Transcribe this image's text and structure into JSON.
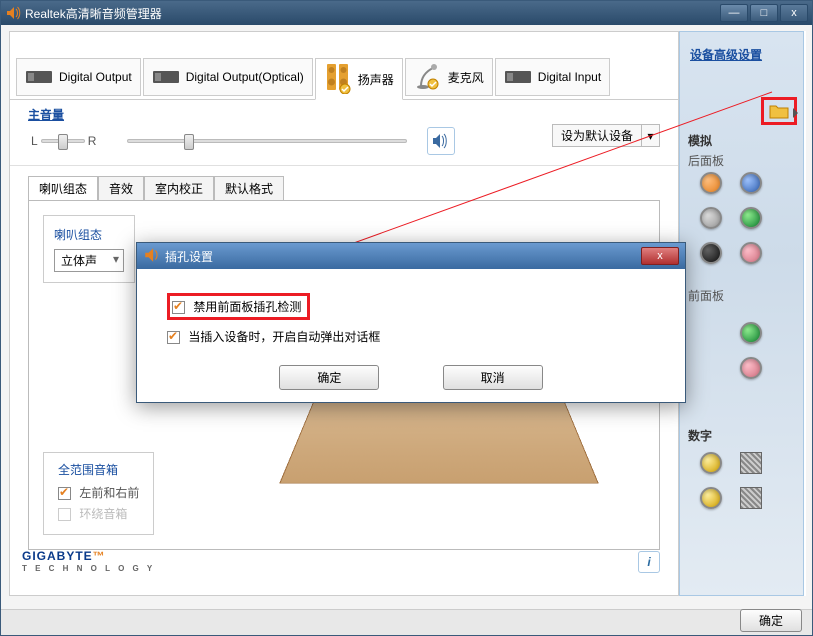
{
  "window": {
    "title": "Realtek高清晰音频管理器",
    "min": "—",
    "max": "□",
    "close": "x"
  },
  "topTabs": {
    "digitalOutput": "Digital Output",
    "digitalOutputOptical": "Digital Output(Optical)",
    "speakers": "扬声器",
    "microphone": "麦克风",
    "digitalInput": "Digital Input"
  },
  "volume": {
    "mainLabel": "主音量",
    "L": "L",
    "R": "R",
    "defaultDevice": "设为默认设备",
    "dropdownArrow": "▾"
  },
  "subTabs": {
    "config": "喇叭组态",
    "effect": "音效",
    "room": "室内校正",
    "format": "默认格式"
  },
  "speakerConfig": {
    "header": "喇叭组态",
    "stereo": "立体声"
  },
  "fullRange": {
    "header": "全范围音箱",
    "frontLR": "左前和右前",
    "surround": "环绕音箱"
  },
  "rightPanel": {
    "advancedLink": "设备高级设置",
    "analog": "模拟",
    "backPanel": "后面板",
    "frontPanel": "前面板",
    "digital": "数字"
  },
  "brand": {
    "name": "GIGABYTE",
    "tag": "T E C H N O L O G Y",
    "info": "i"
  },
  "bottom": {
    "ok": "确定"
  },
  "dialog": {
    "title": "插孔设置",
    "opt1": "禁用前面板插孔检测",
    "opt2": "当插入设备时，开启自动弹出对话框",
    "ok": "确定",
    "cancel": "取消",
    "close": "x"
  }
}
